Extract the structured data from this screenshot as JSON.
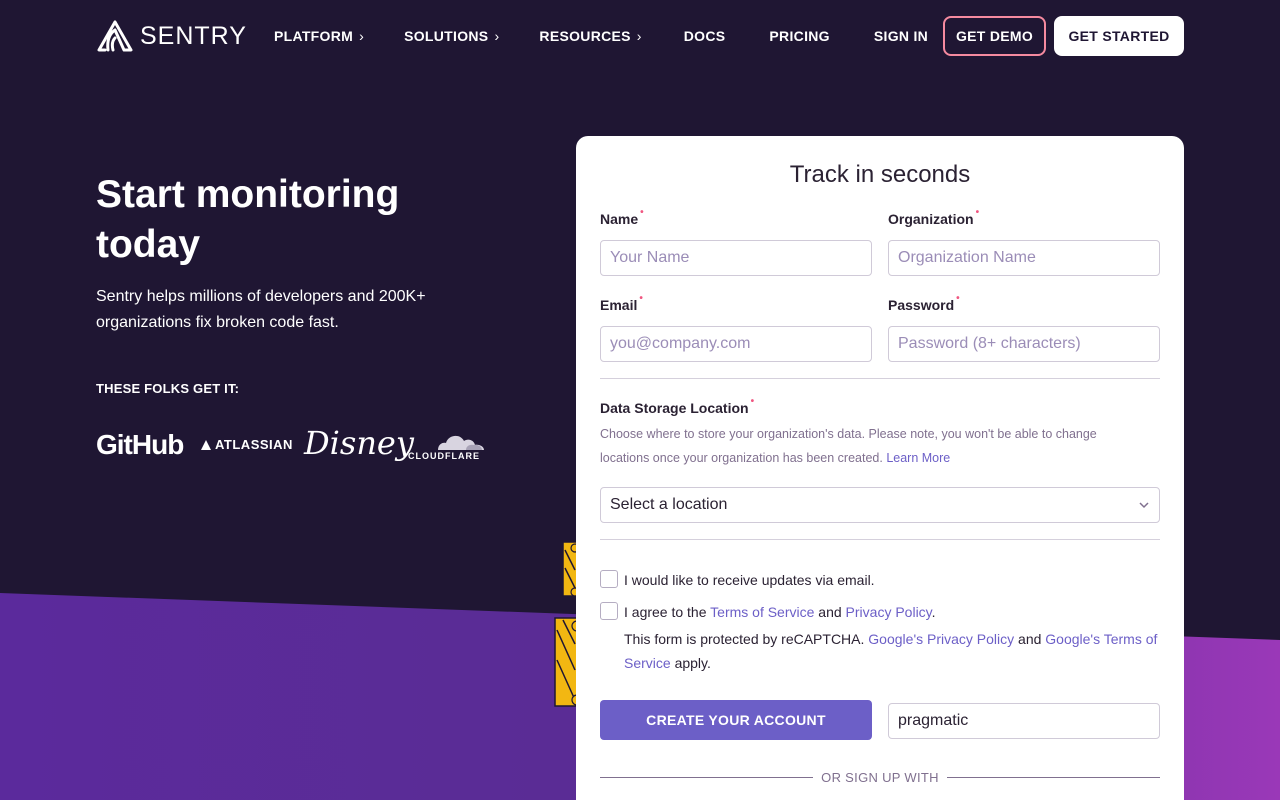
{
  "nav": {
    "brand": "SENTRY",
    "items": [
      {
        "label": "PLATFORM",
        "has_chevron": true
      },
      {
        "label": "SOLUTIONS",
        "has_chevron": true
      },
      {
        "label": "RESOURCES",
        "has_chevron": true
      },
      {
        "label": "DOCS",
        "has_chevron": false
      },
      {
        "label": "PRICING",
        "has_chevron": false
      },
      {
        "label": "SIGN IN",
        "has_chevron": false
      }
    ],
    "chevron": "›",
    "get_demo": "GET DEMO",
    "get_started": "GET STARTED"
  },
  "hero": {
    "title": "Start monitoring today",
    "subtitle": "Sentry helps millions of developers and 200K+ organizations fix broken code fast.",
    "folks_heading": "THESE FOLKS GET IT:",
    "logos": [
      "GitHub",
      "ATLASSIAN",
      "Disney",
      "CLOUDFLARE"
    ]
  },
  "form": {
    "title": "Track in seconds",
    "required_mark": "•",
    "name": {
      "label": "Name",
      "placeholder": "Your Name"
    },
    "organization": {
      "label": "Organization",
      "placeholder": "Organization Name"
    },
    "email": {
      "label": "Email",
      "placeholder": "you@company.com"
    },
    "password": {
      "label": "Password",
      "placeholder": "Password (8+ characters)"
    },
    "storage": {
      "label": "Data Storage Location",
      "hint": "Choose where to store your organization's data. Please note, you won't be able to change locations once your organization has been created.",
      "learn_more": "Learn More",
      "select_value": "Select a location"
    },
    "updates_checkbox": "I would like to receive updates via email.",
    "terms": {
      "prefix": "I agree to the",
      "tos": "Terms of Service",
      "and": "and",
      "privacy": "Privacy Policy",
      "suffix": "."
    },
    "captcha": {
      "prefix": "This form is protected by reCAPTCHA.",
      "google_privacy": "Google's Privacy Policy",
      "and": "and",
      "google_terms": "Google's Terms of Service",
      "suffix": "apply."
    },
    "create_button": "CREATE YOUR ACCOUNT",
    "referrer_value": "pragmatic",
    "or_sign_up": "OR SIGN UP WITH"
  },
  "colors": {
    "bg_dark": "#1f1633",
    "accent_purple": "#6c5fc7",
    "pink": "#f58aa0"
  }
}
